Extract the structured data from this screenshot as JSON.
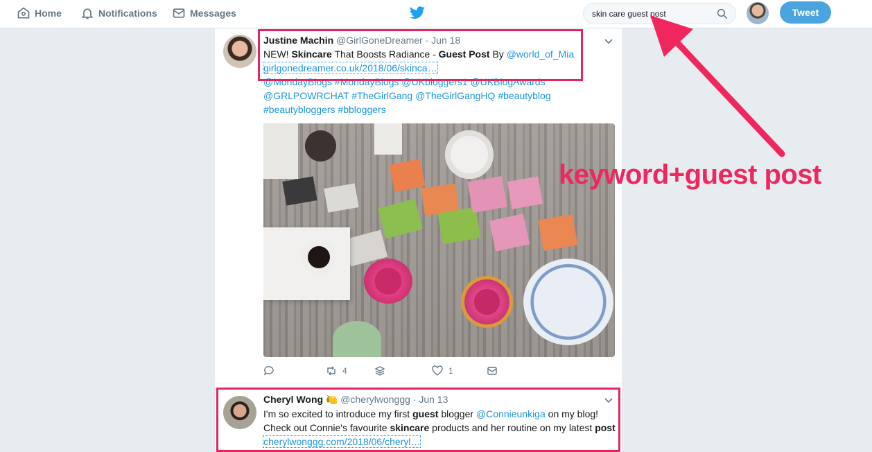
{
  "nav": {
    "home": "Home",
    "notifications": "Notifications",
    "messages": "Messages",
    "tweet_button": "Tweet"
  },
  "search": {
    "value": "skin care guest post"
  },
  "tweets": [
    {
      "name": "Justine Machin",
      "handle": "@GirlGoneDreamer",
      "date": "· Jun 18",
      "line1_a": "NEW! ",
      "line1_b": "Skincare",
      "line1_c": " That Boosts Radiance - ",
      "line1_d": "Guest Post",
      "line1_e": " By ",
      "line1_mention": "@world_of_Mia",
      "link": "girlgonedreamer.co.uk/2018/06/skinca…",
      "line3": "@MondayBlogs #MondayBlogs @UKbloggers1 @UKBlogAwards",
      "line4": "@GRLPOWRCHAT #TheGirlGang @TheGirlGangHQ  #beautyblog",
      "line5": "#beautybloggers #bbloggers",
      "retweets": "4",
      "likes": "1"
    },
    {
      "name": "Cheryl Wong",
      "emoji": "🍋",
      "handle": "@cherylwonggg",
      "date": "· Jun 13",
      "l1_a": "I'm so excited to introduce my first ",
      "l1_b": "guest",
      "l1_c": " blogger ",
      "l1_mention": "@Connieunkiga",
      "l1_d": " on my blog!",
      "l2_a": "Check out Connie's favourite ",
      "l2_b": "skincare",
      "l2_c": " products and her routine on my latest ",
      "l2_d": "post",
      "link": "cherylwonggg.com/2018/06/cheryl…"
    }
  ],
  "annotation": {
    "callout": "keyword+guest post",
    "color": "#f0275f"
  }
}
